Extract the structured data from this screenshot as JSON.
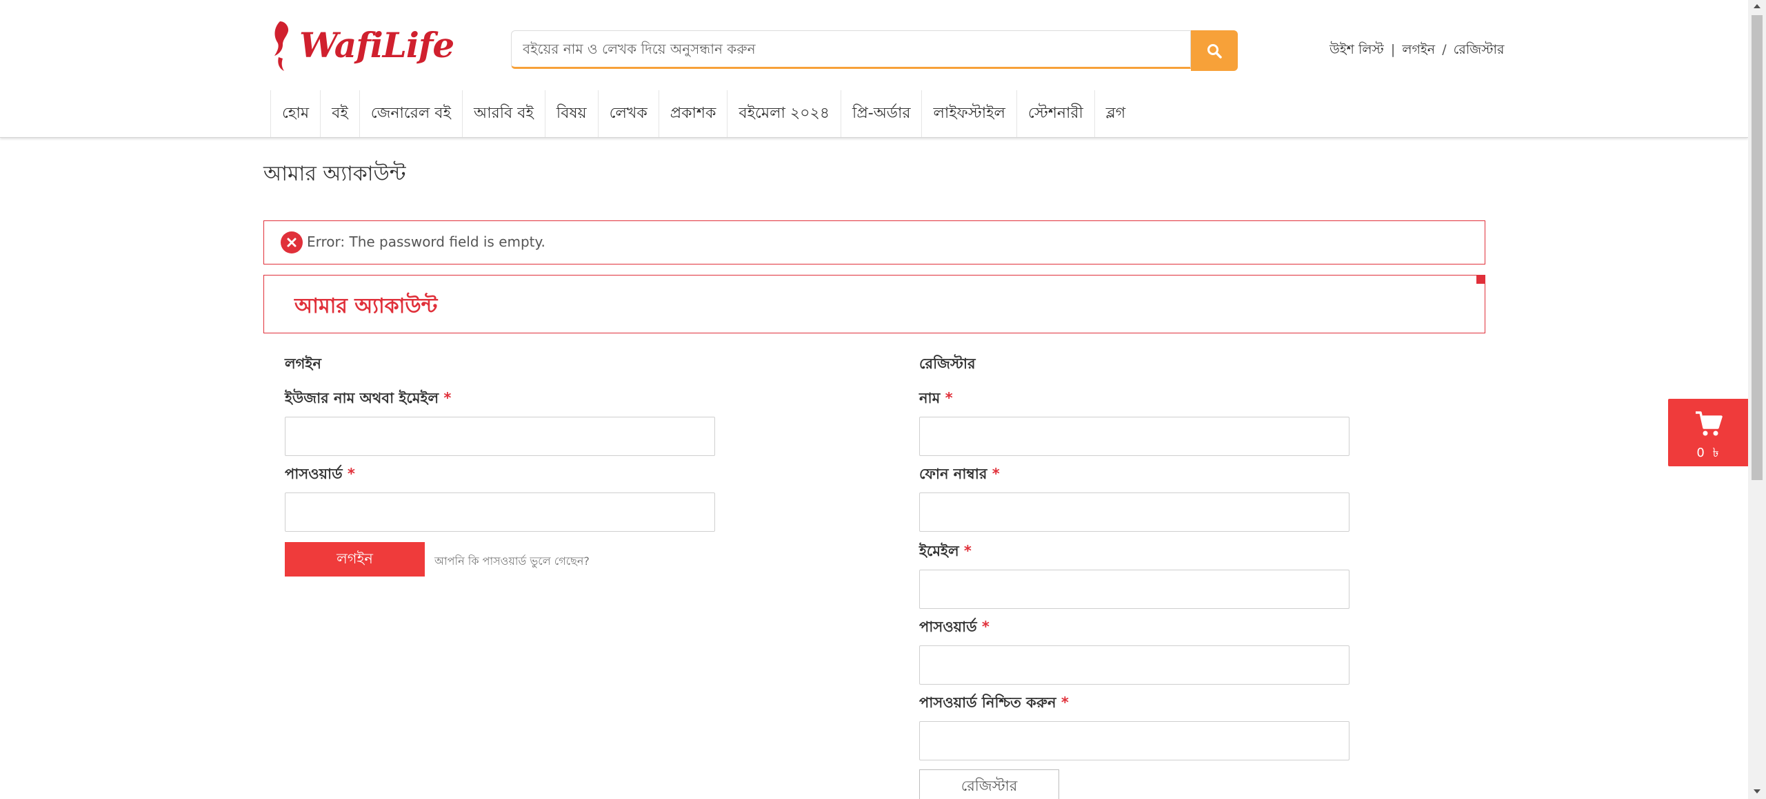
{
  "brand": {
    "logo_text": "WafiLife",
    "accent": "#e0303a",
    "search_accent": "#f7a139"
  },
  "search": {
    "placeholder": "বইয়ের নাম ও লেখক দিয়ে অনুসন্ধান করুন",
    "value": "",
    "button_icon": "search-icon"
  },
  "top_links": {
    "wishlist": "উইশ লিস্ট",
    "separator": "|",
    "login": "লগইন",
    "slash": "/",
    "register": "রেজিস্টার"
  },
  "nav": {
    "items": [
      {
        "label": "হোম"
      },
      {
        "label": "বই"
      },
      {
        "label": "জেনারেল বই"
      },
      {
        "label": "আরবি বই"
      },
      {
        "label": "বিষয়"
      },
      {
        "label": "লেখক"
      },
      {
        "label": "প্রকাশক"
      },
      {
        "label": "বইমেলা ২০২৪"
      },
      {
        "label": "প্রি-অর্ডার"
      },
      {
        "label": "লাইফস্টাইল"
      },
      {
        "label": "স্টেশনারী"
      },
      {
        "label": "ব্লগ"
      }
    ]
  },
  "page": {
    "title": "আমার অ্যাকাউন্ট"
  },
  "error": {
    "message": "Error: The password field is empty.",
    "icon": "error-x-icon"
  },
  "account_banner": {
    "title": "আমার অ্যাকাউন্ট"
  },
  "login": {
    "title": "লগইন",
    "username_label": "ইউজার নাম অথবা ইমেইল",
    "password_label": "পাসওয়ার্ড",
    "required_mark": "*",
    "submit_label": "লগইন",
    "forgot_link": "আপনি কি পাসওয়ার্ড ভুলে গেছেন?"
  },
  "register": {
    "title": "রেজিস্টার",
    "name_label": "নাম",
    "phone_label": "ফোন নাম্বার",
    "email_label": "ইমেইল",
    "password_label": "পাসওয়ার্ড",
    "confirm_label": "পাসওয়ার্ড নিশ্চিত করুন",
    "required_mark": "*",
    "submit_label": "রেজিস্টার"
  },
  "cart": {
    "count": "0 ৳",
    "icon": "cart-icon"
  }
}
